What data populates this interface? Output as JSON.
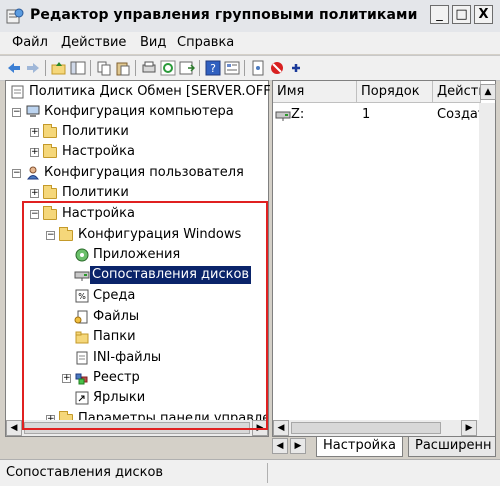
{
  "window": {
    "title": "Редактор управления групповыми политиками",
    "min_symbol": "_",
    "max_symbol": "□",
    "close_symbol": "X"
  },
  "menu": [
    "Файл",
    "Действие",
    "Вид",
    "Справка"
  ],
  "toolbar": {
    "icons": [
      "back-icon",
      "forward-icon",
      "up-folder-icon",
      "show-hide-tree-icon",
      "copy-icon",
      "paste-icon",
      "export-icon",
      "refresh-icon",
      "export-list-icon",
      "help-icon",
      "properties-icon",
      "new-icon",
      "delete-icon",
      "add-icon"
    ]
  },
  "tree": {
    "root": "Политика Диск Обмен [SERVER.OFF",
    "computer_config": "Конфигурация компьютера",
    "computer_policies": "Политики",
    "computer_settings": "Настройка",
    "user_config": "Конфигурация пользователя",
    "user_policies": "Политики",
    "user_settings": "Настройка",
    "windows_config": "Конфигурация Windows",
    "applications": "Приложения",
    "drive_maps": "Сопоставления дисков",
    "environment": "Среда",
    "files": "Файлы",
    "folders": "Папки",
    "ini_files": "INI-файлы",
    "registry": "Реестр",
    "shortcuts": "Ярлыки",
    "control_panel": "Параметры панели управлен"
  },
  "list": {
    "columns": [
      "Имя",
      "Порядок",
      "Действи"
    ],
    "rows": [
      {
        "name": "Z:",
        "order": "1",
        "action": "Создать"
      }
    ]
  },
  "tabs": [
    "Настройка",
    "Расширенн"
  ],
  "status": "Сопоставления дисков",
  "colors": {
    "selection": "#0a246a",
    "highlight_box": "#e02020"
  }
}
